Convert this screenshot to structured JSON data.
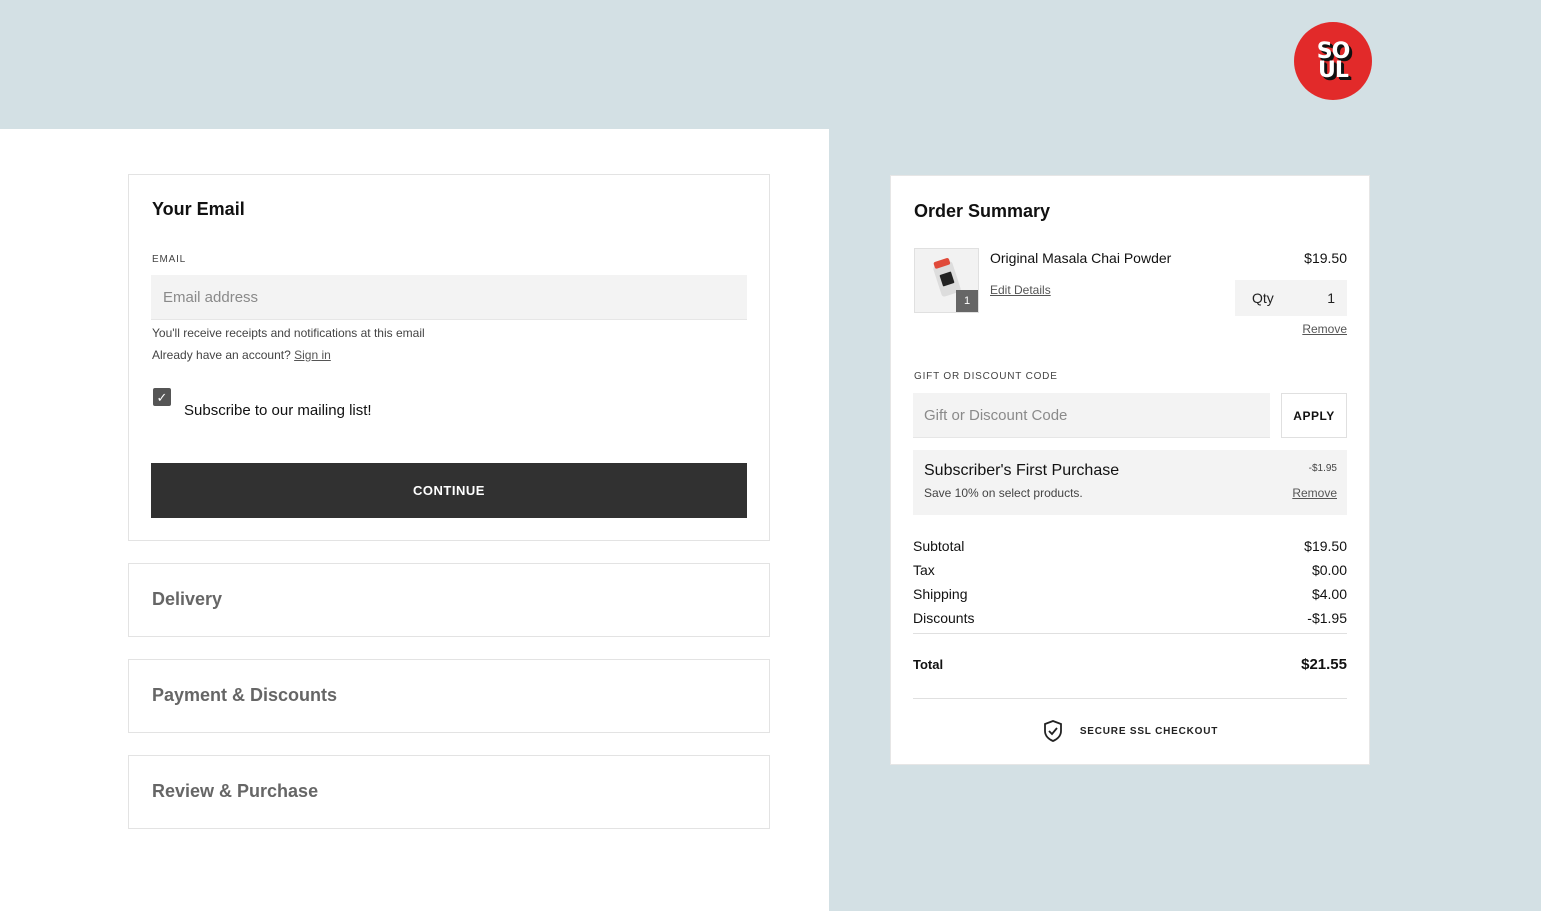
{
  "brand": {
    "logo_line1": "SO",
    "logo_line2": "UL",
    "logo_color": "#e22a2a"
  },
  "email_section": {
    "title": "Your Email",
    "field_label": "EMAIL",
    "email_placeholder": "Email address",
    "email_value": "",
    "hint": "You'll receive receipts and notifications at this email",
    "account_prompt": "Already have an account?",
    "sign_in_link": "Sign in",
    "subscribe_label": "Subscribe to our mailing list!",
    "subscribe_checked": true,
    "continue_label": "CONTINUE"
  },
  "steps": [
    {
      "label": "Delivery"
    },
    {
      "label": "Payment & Discounts"
    },
    {
      "label": "Review & Purchase"
    }
  ],
  "order_summary": {
    "title": "Order Summary",
    "item": {
      "name": "Original Masala Chai Powder",
      "price": "$19.50",
      "badge_qty": "1",
      "edit_link": "Edit Details",
      "qty_label": "Qty",
      "qty_value": "1",
      "remove_link": "Remove"
    },
    "gift_label": "GIFT OR DISCOUNT CODE",
    "gift_placeholder": "Gift or Discount Code",
    "apply_label": "APPLY",
    "promo": {
      "title": "Subscriber's First Purchase",
      "description": "Save 10% on select products.",
      "amount": "-$1.95",
      "remove_link": "Remove"
    },
    "totals": [
      {
        "label": "Subtotal",
        "value": "$19.50"
      },
      {
        "label": "Tax",
        "value": "$0.00"
      },
      {
        "label": "Shipping",
        "value": "$4.00"
      },
      {
        "label": "Discounts",
        "value": "-$1.95"
      }
    ],
    "total": {
      "label": "Total",
      "value": "$21.55"
    },
    "secure_text": "SECURE SSL CHECKOUT"
  },
  "colors": {
    "background": "#d3e0e4",
    "button_dark": "#313131",
    "input_bg": "#f3f3f3"
  },
  "icons": [
    "check-icon",
    "shield-check-icon",
    "product-thumbnail"
  ]
}
